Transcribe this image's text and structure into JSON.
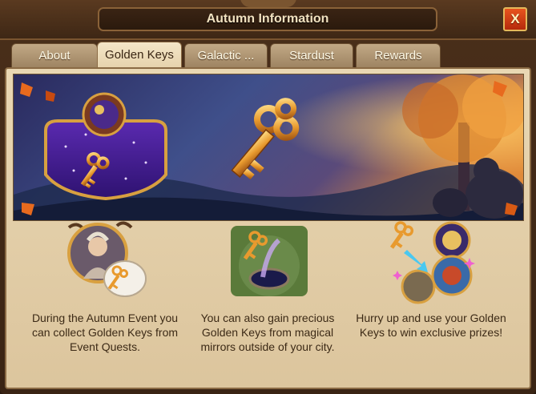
{
  "window": {
    "title": "Autumn Information",
    "close_label": "X"
  },
  "tabs": [
    {
      "label": "About",
      "active": false
    },
    {
      "label": "Golden Keys",
      "active": true
    },
    {
      "label": "Galactic ...",
      "active": false
    },
    {
      "label": "Stardust",
      "active": false
    },
    {
      "label": "Rewards",
      "active": false
    }
  ],
  "info_tiles": [
    {
      "icon": "autumn-quest-giver-icon",
      "text": "During the Autumn Event you can collect Golden Keys from Event Quests."
    },
    {
      "icon": "magic-mirror-icon",
      "text": "You can also gain precious Golden Keys from magical mirrors outside of your city."
    },
    {
      "icon": "key-to-prizes-icon",
      "text": "Hurry up and use your Golden Keys to win exclusive prizes!"
    }
  ],
  "colors": {
    "accent_gold": "#e8a83a",
    "close_button": "#d84216",
    "panel": "#e9d7b3"
  }
}
